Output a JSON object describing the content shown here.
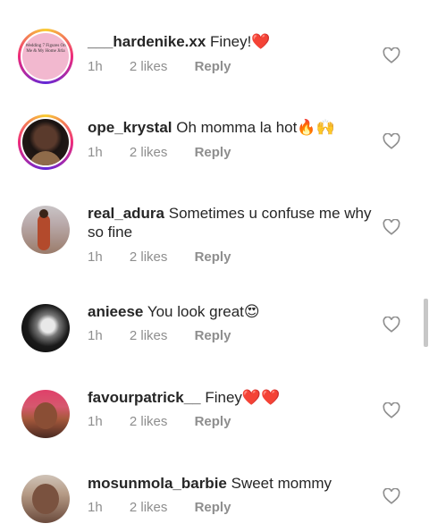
{
  "comments": [
    {
      "username": "___hardenike.xx",
      "text": "Finey!❤️",
      "time": "1h",
      "likes": "2 likes",
      "reply": "Reply",
      "avatar_text": "Wedding 7 Figures On Me & My Home Jirla"
    },
    {
      "username": "ope_krystal",
      "text": "Oh momma la hot🔥🙌",
      "time": "1h",
      "likes": "2 likes",
      "reply": "Reply"
    },
    {
      "username": "real_adura",
      "text": "Sometimes u confuse me why so fine",
      "time": "1h",
      "likes": "2 likes",
      "reply": "Reply"
    },
    {
      "username": "anieese",
      "text": "You look great😍",
      "time": "1h",
      "likes": "2 likes",
      "reply": "Reply"
    },
    {
      "username": "favourpatrick__",
      "text": "Finey❤️❤️",
      "time": "1h",
      "likes": "2 likes",
      "reply": "Reply"
    },
    {
      "username": "mosunmola_barbie",
      "text": "Sweet mommy",
      "time": "1h",
      "likes": "2 likes",
      "reply": "Reply"
    }
  ]
}
